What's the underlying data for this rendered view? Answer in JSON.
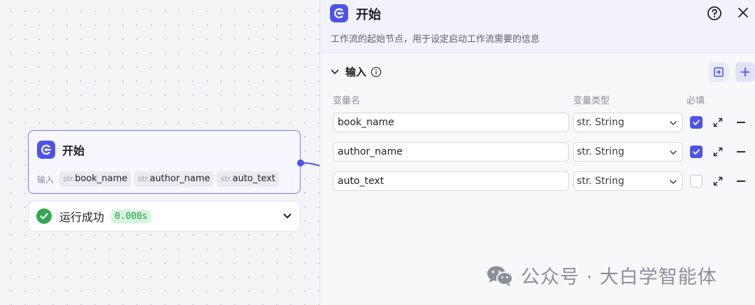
{
  "node": {
    "title": "开始",
    "inputs_label": "输入",
    "type_prefix": "str.",
    "params": [
      "book_name",
      "author_name",
      "auto_text"
    ]
  },
  "status": {
    "text": "运行成功",
    "time": "0.000s"
  },
  "panel": {
    "title": "开始",
    "description": "工作流的起始节点，用于设定启动工作流需要的信息",
    "section_title": "输入",
    "columns": {
      "name": "变量名",
      "type": "变量类型",
      "required": "必填"
    },
    "rows": [
      {
        "name": "book_name",
        "type_prefix": "str.",
        "type": "String",
        "required": true
      },
      {
        "name": "author_name",
        "type_prefix": "str.",
        "type": "String",
        "required": true
      },
      {
        "name": "auto_text",
        "type_prefix": "str.",
        "type": "String",
        "required": false
      }
    ]
  },
  "watermark": {
    "text": "公众号 · 大白学智能体"
  },
  "colors": {
    "accent": "#4d53e8",
    "success": "#32a852"
  }
}
